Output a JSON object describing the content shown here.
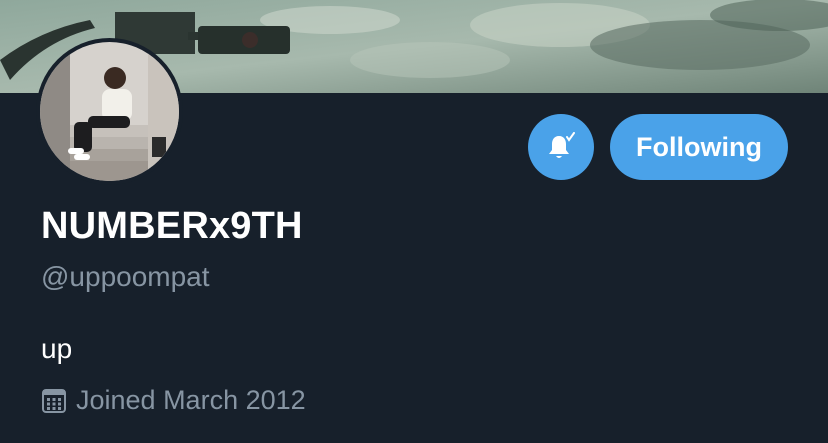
{
  "profile": {
    "display_name": "NUMBERx9TH",
    "handle": "@uppoompat",
    "bio": "up",
    "joined": "Joined March 2012"
  },
  "actions": {
    "notifications_icon": "bell-check-icon",
    "follow_label": "Following"
  },
  "icons": {
    "calendar": "calendar-icon"
  },
  "colors": {
    "background": "#17202b",
    "accent": "#4aa2e9",
    "secondary_text": "#8795a3",
    "primary_text": "#ffffff"
  }
}
